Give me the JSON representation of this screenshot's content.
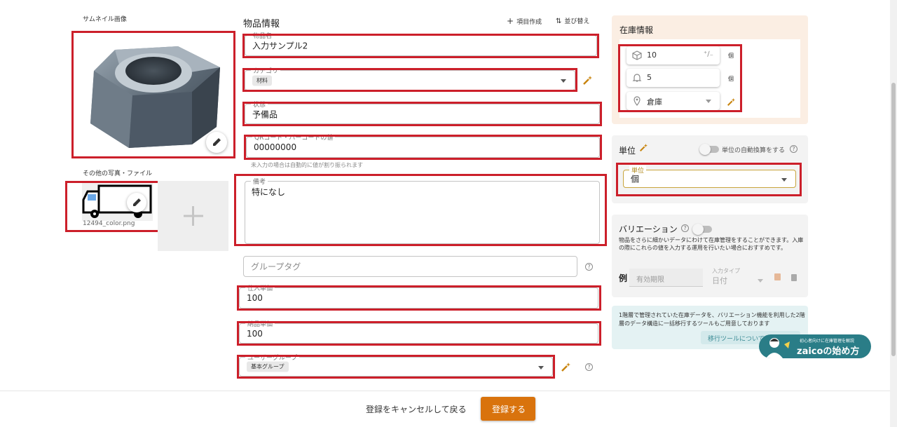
{
  "thumbnail": {
    "label": "サムネイル画像"
  },
  "other_files": {
    "label": "その他の写真・ファイル",
    "file_name": "12494_color.png"
  },
  "item_info": {
    "title": "物品情報",
    "create_field": "項目作成",
    "reorder": "並び替え",
    "name": {
      "label": "物品名",
      "value": "入力サンプル2"
    },
    "category": {
      "label": "カテゴリ",
      "chip": "材料"
    },
    "status": {
      "label": "状態",
      "value": "予備品"
    },
    "qr": {
      "label": "QRコード・バーコードの値",
      "value": "00000000",
      "hint": "未入力の場合は自動的に値が割り振られます"
    },
    "remarks": {
      "label": "備考",
      "value": "特になし"
    },
    "group_tag": {
      "placeholder": "グループタグ"
    },
    "purchase_price": {
      "label": "仕入単価",
      "value": "100"
    },
    "selling_price": {
      "label": "納品単価",
      "value": "100"
    },
    "user_group": {
      "label": "ユーザーグループ",
      "chip": "基本グループ"
    }
  },
  "stock": {
    "title": "在庫情報",
    "quantity": "10",
    "quantity_unit": "個",
    "alert": "5",
    "alert_unit": "個",
    "location": "倉庫"
  },
  "unit": {
    "title": "単位",
    "auto_convert": "単位の自動換算をする",
    "field_label": "単位",
    "value": "個"
  },
  "variation": {
    "title": "バリエーション",
    "description": "物品をさらに細かいデータにわけて在庫管理をすることができます。入庫の際にこれらの値を入力する運用を行いたい場合におすすめです。",
    "example_label": "例",
    "example_placeholder": "有効期限",
    "input_type_label": "入力タイプ",
    "input_type_value": "日付"
  },
  "migration": {
    "text": "1階層で管理されていた在庫データを、バリエーション機能を利用した2階層のデータ構造に一括移行するツールもご用意しております",
    "button": "移行ツールについて"
  },
  "promo": {
    "small": "初心者向けに在庫管理を解説",
    "title": "zaicoの始め方"
  },
  "footer": {
    "cancel": "登録をキャンセルして戻る",
    "submit": "登録する"
  },
  "colors": {
    "accent": "#d9730d",
    "red_box": "#cc1f2a",
    "stock_bg": "#fbeee3",
    "promo": "#2a7d87"
  }
}
